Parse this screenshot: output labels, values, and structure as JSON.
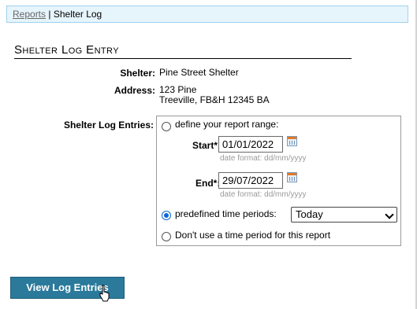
{
  "breadcrumb": {
    "link": "Reports",
    "separator": "|",
    "current": "Shelter Log"
  },
  "heading": "Shelter Log Entry",
  "shelter": {
    "label": "Shelter:",
    "value": "Pine Street Shelter"
  },
  "address": {
    "label": "Address:",
    "line1": "123 Pine",
    "line2": "Treeville, FB&H 12345 BA"
  },
  "entries": {
    "label": "Shelter Log Entries:",
    "option_range": "define your report range:",
    "start_label": "Start*:",
    "start_value": "01/01/2022",
    "end_label": "End*:",
    "end_value": "29/07/2022",
    "date_hint": "date format: dd/mm/yyyy",
    "option_predefined": "predefined time periods:",
    "period_selected": "Today",
    "option_none": "Don't use a time period for this report",
    "selected_option": "predefined"
  },
  "button": "View Log Entries"
}
